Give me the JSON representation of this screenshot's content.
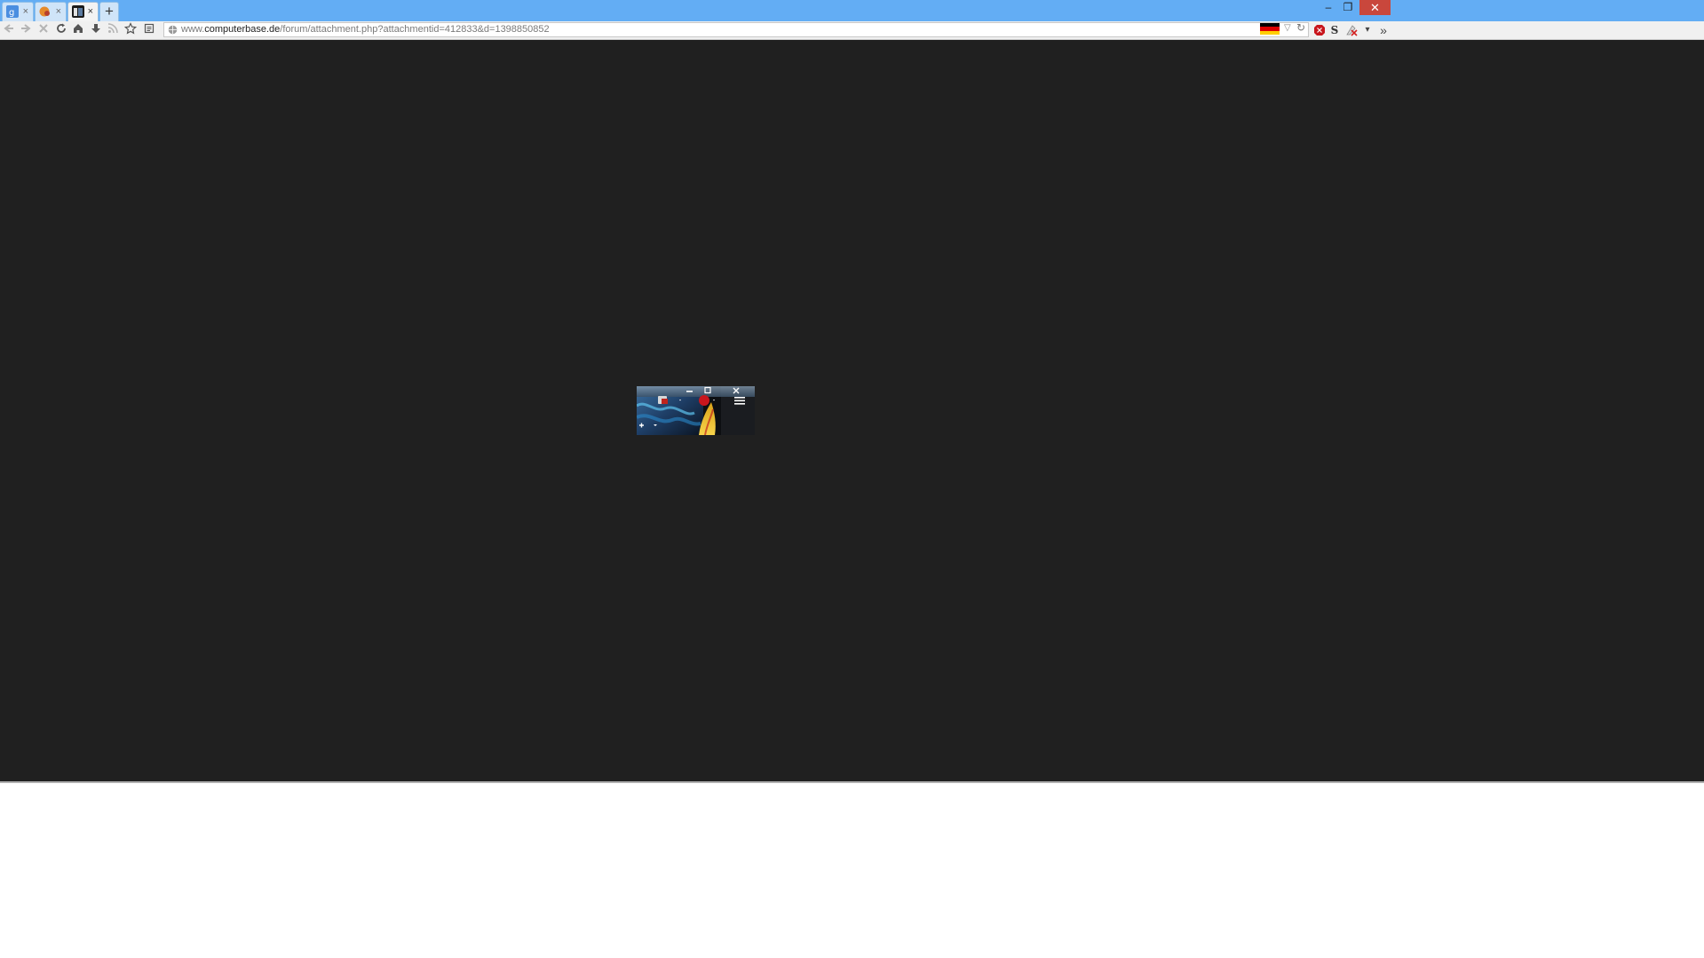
{
  "tabs": [
    {
      "favicon": "google-icon",
      "close_label": "×"
    },
    {
      "favicon": "computerbase-icon",
      "close_label": "×"
    },
    {
      "favicon": "image-icon",
      "close_label": "×"
    }
  ],
  "new_tab_label": "+",
  "window_controls": {
    "minimize": "–",
    "maximize": "❐",
    "close": "✕"
  },
  "nav": {
    "back": "back-icon",
    "forward": "forward-icon",
    "stop": "stop-icon",
    "reload": "reload-icon",
    "home": "home-icon",
    "download": "download-icon",
    "rss": "rss-icon",
    "bookmark": "star-icon",
    "reader": "reader-icon"
  },
  "url": {
    "prefix": "www.",
    "domain": "computerbase.de",
    "path": "/forum/attachment.php?attachmentid=412833&d=1398850852"
  },
  "url_actions": {
    "dropdown": "▽",
    "reload": "↻"
  },
  "toolbar_extras": {
    "adblock": "adblock-icon",
    "s_icon_label": "S",
    "menu_dropdown": "▾",
    "overflow": "»"
  },
  "colors": {
    "tabbar": "#63adf4",
    "page_background": "#202020",
    "close_button": "#c9473c"
  },
  "image": {
    "description_icons": [
      "minimize-icon",
      "maximize-icon",
      "close-icon",
      "menu-icon",
      "abp-icon",
      "add-icon"
    ]
  }
}
